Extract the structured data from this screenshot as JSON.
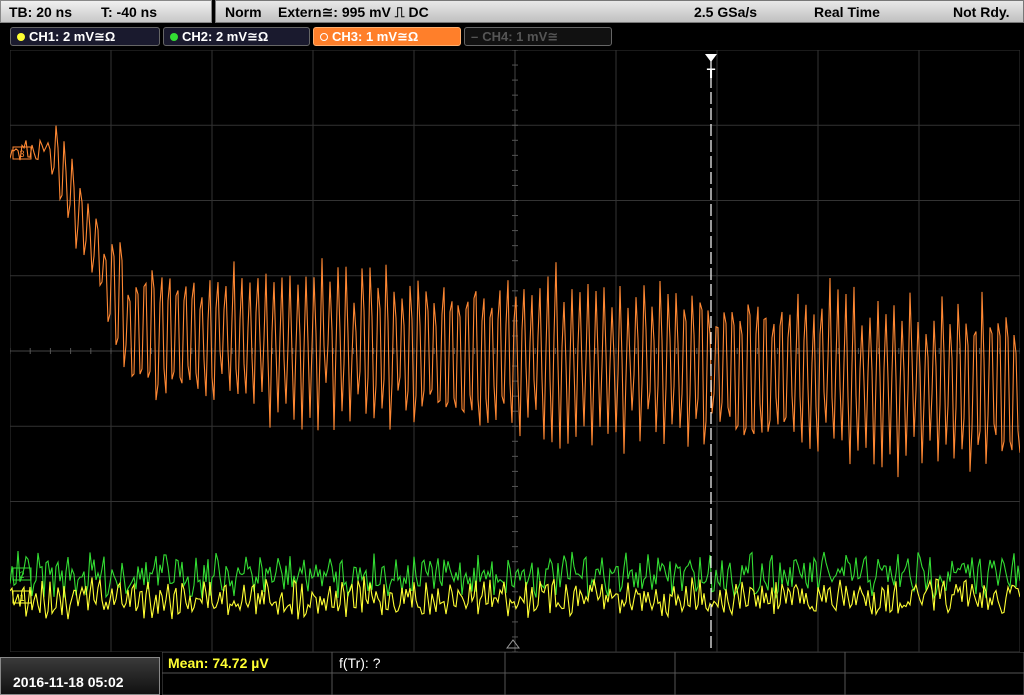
{
  "status": {
    "timebase": "TB: 20 ns",
    "trigger_time": "T: -40 ns",
    "acq_mode": "Norm",
    "trigger_source": "Extern≅: 995 mV ⎍ DC",
    "sample_rate": "2.5 GSa/s",
    "realtime": "Real Time",
    "state": "Not Rdy."
  },
  "channels": [
    {
      "label": "CH1: 2 mV≅Ω",
      "color": "#ffff33"
    },
    {
      "label": "CH2: 2 mV≅Ω",
      "color": "#33dd33"
    },
    {
      "label": "CH3: 1 mV≅Ω",
      "color": "#ff8833"
    },
    {
      "label": "CH4: 1 mV≅",
      "color": "#666666"
    }
  ],
  "markers": {
    "trigger": "T",
    "ch1": "1",
    "ch2": "2",
    "ch3": "3"
  },
  "datetime": "2016-11-18 05:02",
  "measurements": {
    "mean": "Mean: 74.72 µV",
    "ftr": "f(Tr): ?"
  },
  "icons": [
    "trigger-position-icon",
    "ground-marker-icon"
  ]
}
